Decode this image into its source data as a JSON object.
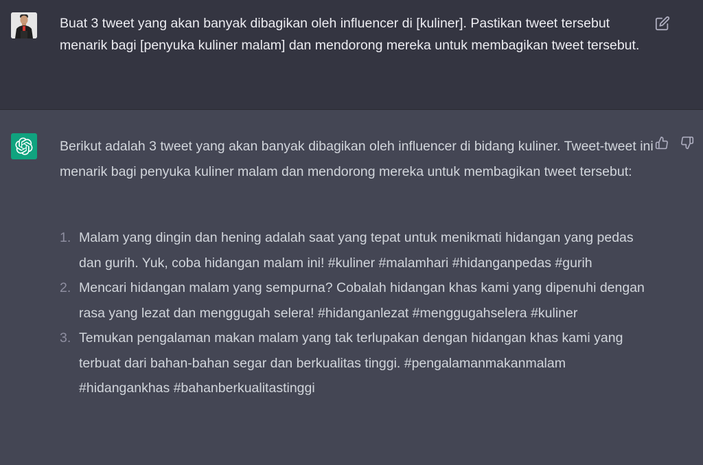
{
  "user_message": {
    "text": "Buat 3 tweet yang akan banyak dibagikan oleh influencer di [kuliner]. Pastikan tweet tersebut menarik bagi [penyuka kuliner malam] dan mendorong mereka untuk membagikan tweet tersebut.",
    "edit_icon": "edit-icon"
  },
  "assistant_message": {
    "intro": "Berikut adalah 3 tweet yang akan banyak dibagikan oleh influencer di bidang kuliner. Tweet-tweet ini menarik bagi penyuka kuliner malam dan mendorong mereka untuk membagikan tweet tersebut:",
    "tweets": [
      {
        "number": "1.",
        "text": "Malam yang dingin dan hening adalah saat yang tepat untuk menikmati hidangan yang pedas dan gurih. Yuk, coba hidangan malam ini! #kuliner #malamhari #hidanganpedas #gurih"
      },
      {
        "number": "2.",
        "text": "Mencari hidangan malam yang sempurna? Cobalah hidangan khas kami yang dipenuhi dengan rasa yang lezat dan menggugah selera! #hidanganlezat #menggugahselera #kuliner"
      },
      {
        "number": "3.",
        "text": "Temukan pengalaman makan malam yang tak terlupakan dengan hidangan khas kami yang terbuat dari bahan-bahan segar dan berkualitas tinggi. #pengalamanmakanmalam #hidangankhas #bahanberkualitastinggi"
      }
    ],
    "feedback_icons": [
      "thumbs-up-icon",
      "thumbs-down-icon"
    ]
  },
  "colors": {
    "user_bg": "#343541",
    "assistant_bg": "#444654",
    "gpt_avatar_bg": "#10a37f",
    "text": "#d1d5db"
  }
}
